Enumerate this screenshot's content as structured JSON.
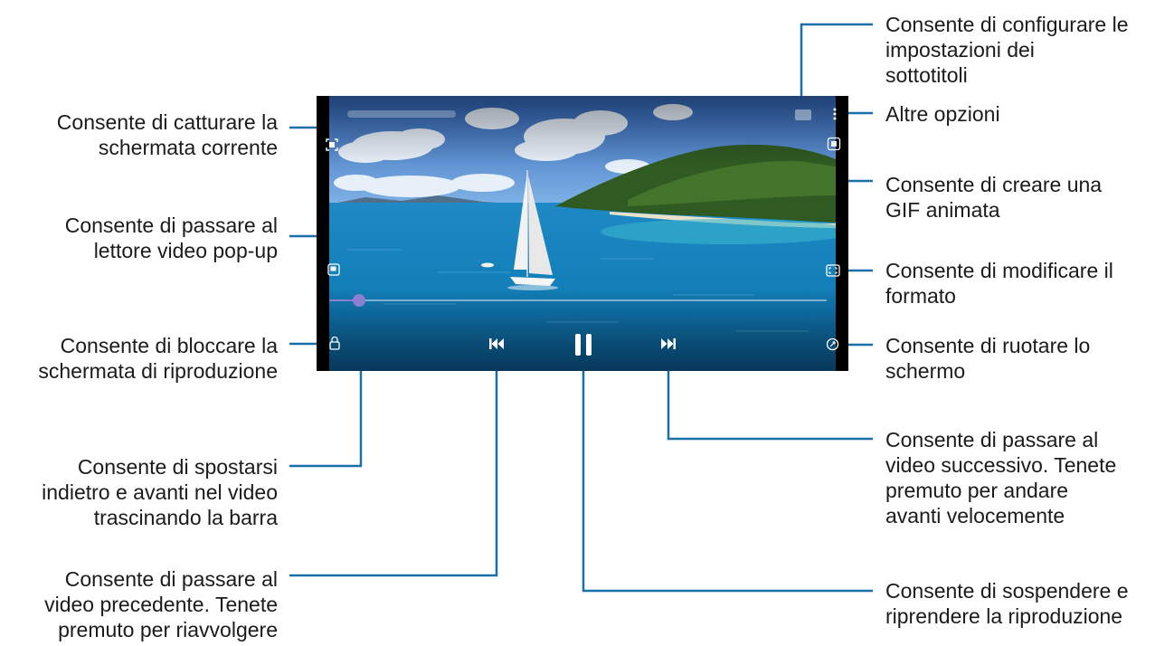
{
  "annotations": {
    "left": {
      "capture": [
        "Consente di catturare la",
        "schermata corrente"
      ],
      "popup": [
        "Consente di passare al",
        "lettore video pop-up"
      ],
      "lock": [
        "Consente di bloccare la",
        "schermata di riproduzione"
      ],
      "seek": [
        "Consente di spostarsi",
        "indietro e avanti nel video",
        "trascinando la barra"
      ],
      "previous": [
        "Consente di passare al",
        "video precedente. Tenete",
        "premuto per riavvolgere"
      ]
    },
    "right": {
      "subtitles": [
        "Consente di configurare le",
        "impostazioni dei",
        "sottotitoli"
      ],
      "more": [
        "Altre opzioni"
      ],
      "gif": [
        "Consente di creare una",
        "GIF animata"
      ],
      "ratio": [
        "Consente di modificare il",
        "formato"
      ],
      "rotate": [
        "Consente di ruotare lo",
        "schermo"
      ],
      "next": [
        "Consente di passare al",
        "video successivo. Tenete",
        "premuto per andare",
        "avanti velocemente"
      ],
      "pause": [
        "Consente di sospendere e",
        "riprendere la riproduzione"
      ]
    }
  },
  "player": {
    "progress_fraction": 0.06
  },
  "colors": {
    "leader_line": "#1a6fa8",
    "seek_thumb": "#8a7fd0"
  }
}
